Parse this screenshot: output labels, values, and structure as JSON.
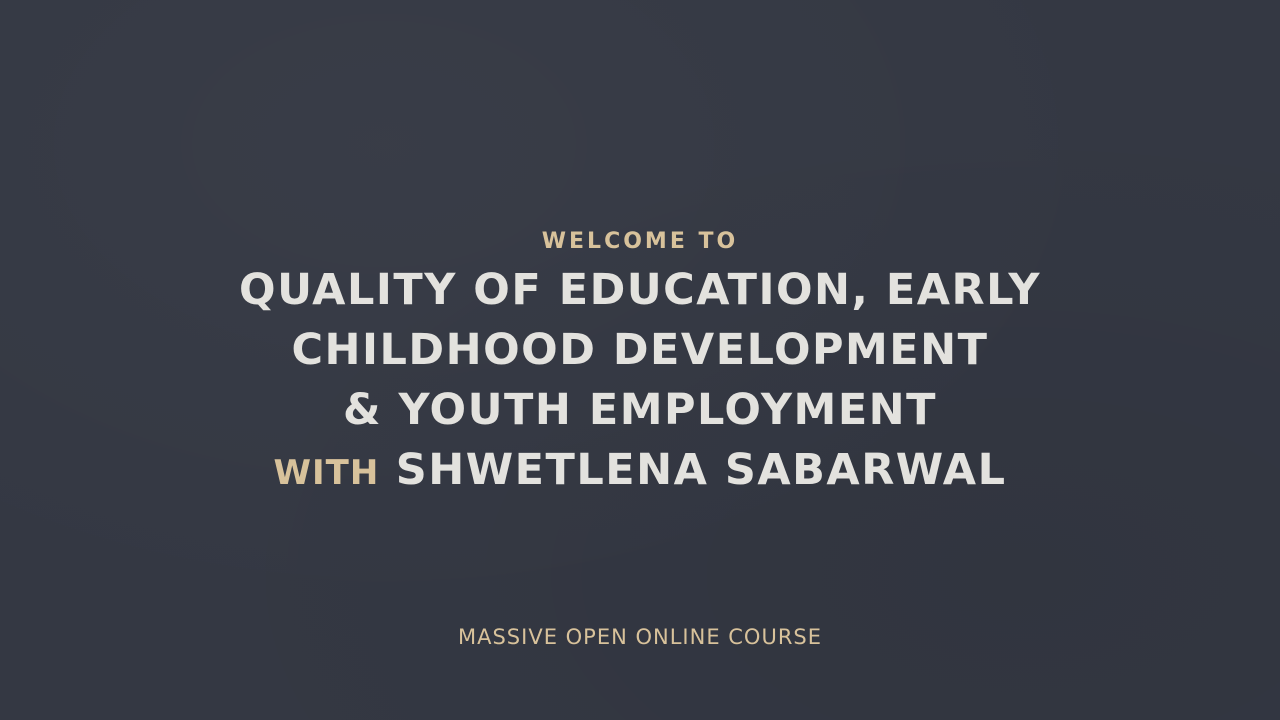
{
  "slide": {
    "welcome": "WELCOME TO",
    "course_lines": [
      "QUALITY OF EDUCATION, EARLY",
      "CHILDHOOD DEVELOPMENT",
      "& YOUTH EMPLOYMENT"
    ],
    "with_word": "WITH",
    "instructor": "SHWETLENA SABARWAL",
    "footer": "MASSIVE OPEN ONLINE COURSE"
  },
  "colors": {
    "background": "#343843",
    "accent_gold": "#d8c29b",
    "title_white": "#e3e2de"
  }
}
